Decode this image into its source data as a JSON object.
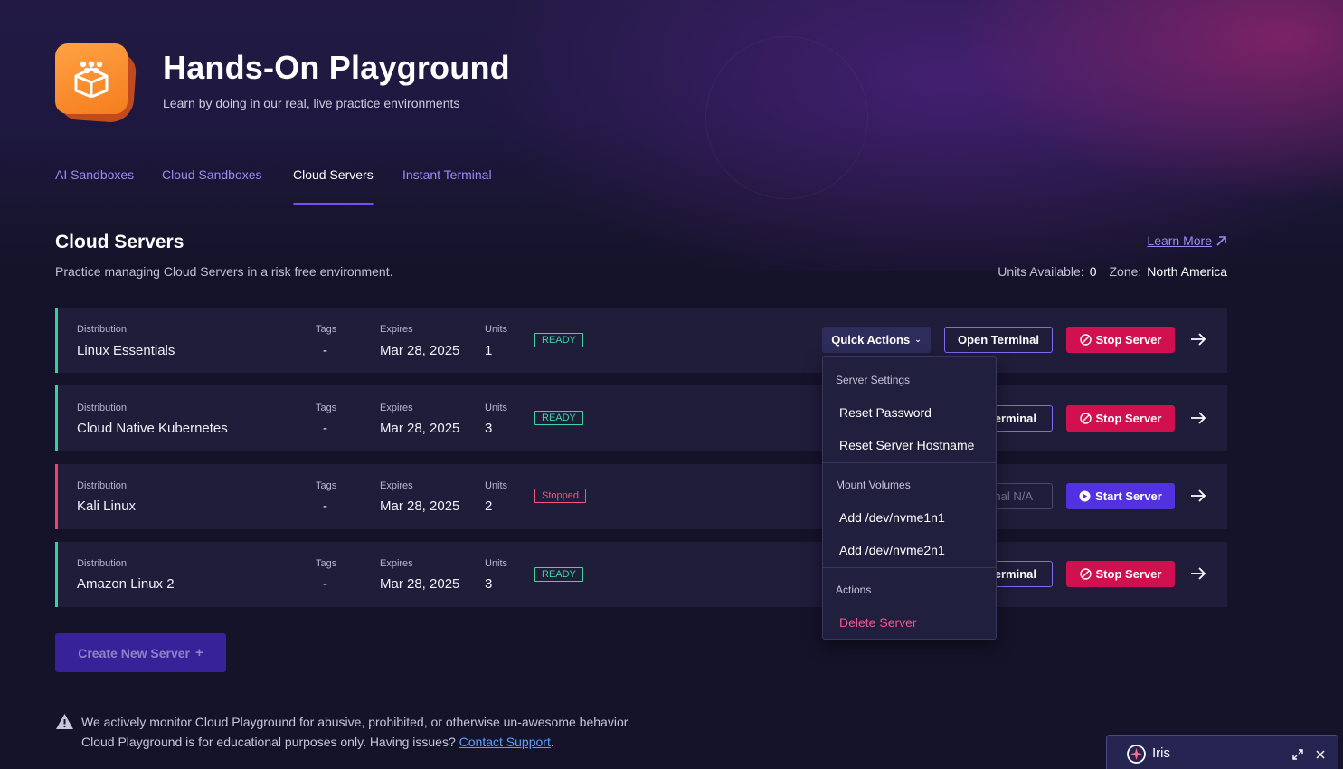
{
  "header": {
    "title": "Hands-On Playground",
    "subtitle": "Learn by doing in our real, live practice environments"
  },
  "tabs": [
    {
      "label": "AI Sandboxes",
      "active": false
    },
    {
      "label": "Cloud Sandboxes",
      "active": false
    },
    {
      "label": "Cloud Servers",
      "active": true
    },
    {
      "label": "Instant Terminal",
      "active": false
    }
  ],
  "section": {
    "title": "Cloud Servers",
    "description": "Practice managing Cloud Servers in a risk free environment.",
    "learn_more": "Learn More",
    "units_label": "Units Available:",
    "units_value": "0",
    "zone_label": "Zone:",
    "zone_value": "North America"
  },
  "columns": {
    "distribution": "Distribution",
    "tags": "Tags",
    "expires": "Expires",
    "units": "Units"
  },
  "servers": [
    {
      "distribution": "Linux Essentials",
      "tags": "-",
      "expires": "Mar 28, 2025",
      "units": "1",
      "status": "READY",
      "quick_actions": "Quick Actions",
      "terminal": "Open Terminal",
      "power_action": "Stop Server",
      "accent": "#31d39b"
    },
    {
      "distribution": "Cloud Native Kubernetes",
      "tags": "-",
      "expires": "Mar 28, 2025",
      "units": "3",
      "status": "READY",
      "terminal": "erminal",
      "power_action": "Stop Server",
      "accent": "#31d39b"
    },
    {
      "distribution": "Kali Linux",
      "tags": "-",
      "expires": "Mar 28, 2025",
      "units": "2",
      "status": "Stopped",
      "terminal": "nal N/A",
      "power_action": "Start Server",
      "accent": "#f0416e"
    },
    {
      "distribution": "Amazon Linux 2",
      "tags": "-",
      "expires": "Mar 28, 2025",
      "units": "3",
      "status": "READY",
      "terminal": "erminal",
      "power_action": "Stop Server",
      "accent": "#31d39b"
    }
  ],
  "quick_actions_menu": {
    "server_settings": "Server Settings",
    "reset_password": "Reset Password",
    "reset_hostname": "Reset Server Hostname",
    "mount_volumes": "Mount Volumes",
    "add_vol1": "Add /dev/nvme1n1",
    "add_vol2": "Add /dev/nvme2n1",
    "actions": "Actions",
    "delete": "Delete Server"
  },
  "create_button": "Create New Server",
  "notice": {
    "line1": "We actively monitor Cloud Playground for abusive, prohibited, or otherwise un-awesome behavior.",
    "line2_prefix": "Cloud Playground is for educational purposes only. Having issues? ",
    "link": "Contact Support",
    "line2_suffix": "."
  },
  "iris": {
    "label": "Iris"
  },
  "colors": {
    "accent_purple": "#7a4cf3",
    "ready_green": "#3fd6a4",
    "stopped_red": "#f3557e",
    "stop_button": "#d1114f",
    "start_button": "#5131e0",
    "logo_orange": "#f57d1e"
  },
  "icons": {
    "logo": "building-blocks-icon",
    "learn_more": "external-arrow-icon",
    "row_arrow": "arrow-right-icon",
    "stop": "stop-circle-icon",
    "start": "play-circle-icon",
    "warning": "warning-triangle-icon",
    "iris": "iris-sparkle-icon"
  }
}
